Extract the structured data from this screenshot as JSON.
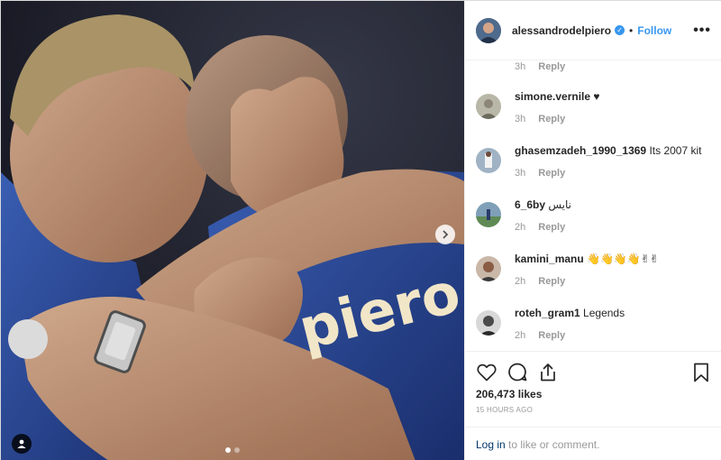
{
  "post": {
    "username": "alessandrodelpiero",
    "follow_label": "Follow",
    "separator": "•",
    "more_label": "•••",
    "jersey_text": "piero"
  },
  "first_meta": {
    "time": "3h",
    "reply": "Reply"
  },
  "comments": [
    {
      "user": "simone.vernile",
      "text": "♥",
      "time": "3h",
      "reply": "Reply",
      "avatar_color": "#b9b7a7"
    },
    {
      "user": "ghasemzadeh_1990_1369",
      "text": "Its 2007 kit",
      "time": "3h",
      "reply": "Reply",
      "avatar_color": "#8fa3b5"
    },
    {
      "user": "6_6by",
      "text": "نایس",
      "time": "2h",
      "reply": "Reply",
      "avatar_color": "#6b8c6e"
    },
    {
      "user": "kamini_manu",
      "text": "👋👋👋👋✌✌",
      "time": "2h",
      "reply": "Reply",
      "avatar_color": "#8a6e5c"
    },
    {
      "user": "roteh_gram1",
      "text": "Legends",
      "time": "2h",
      "reply": "Reply",
      "avatar_color": "#4a4a4a"
    }
  ],
  "actions": {
    "likes": "206,473 likes",
    "timestamp": "15 HOURS AGO",
    "login_link": "Log in",
    "login_rest": " to like or comment."
  },
  "icons": {
    "like": "heart-icon",
    "comment": "comment-icon",
    "share": "share-icon",
    "save": "bookmark-icon",
    "next": "chevron-right-icon",
    "tag": "user-tag-icon"
  },
  "colors": {
    "accent": "#3897f0",
    "jersey": "#2a4fa8",
    "link": "#003569"
  }
}
